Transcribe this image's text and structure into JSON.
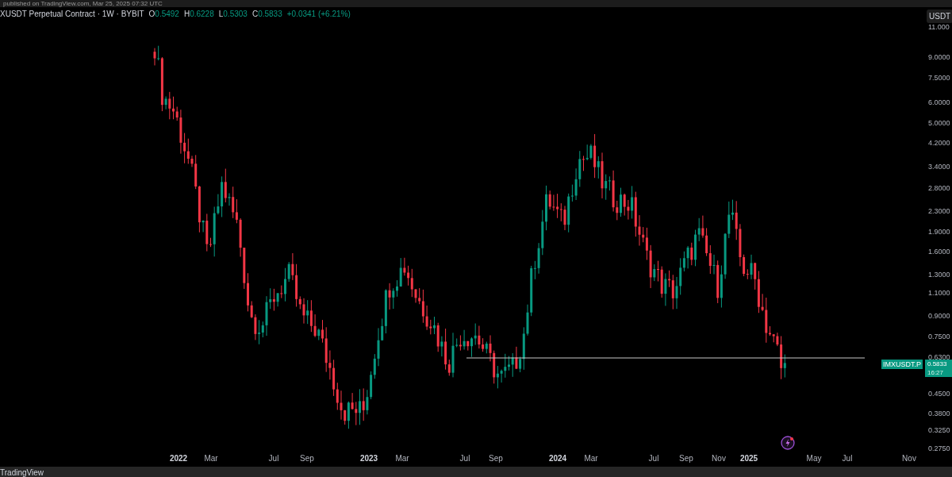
{
  "caption": "published on TradingView.com, Mar 25, 2025 07:32 UTC",
  "legend": {
    "symbol": "XUSDT Perpetual Contract · 1W · BYBIT",
    "ohlc": [
      {
        "label": "O",
        "value": "0.5492"
      },
      {
        "label": "H",
        "value": "0.6228"
      },
      {
        "label": "L",
        "value": "0.5303"
      },
      {
        "label": "C",
        "value": "0.5833"
      }
    ],
    "change": "+0.0341 (+6.21%)"
  },
  "currency_button": "USDT",
  "price_axis": [
    "11.000",
    "9.0000",
    "7.5000",
    "6.0000",
    "5.0000",
    "4.2000",
    "3.4000",
    "2.8000",
    "2.3000",
    "1.9000",
    "1.6000",
    "1.3000",
    "1.1000",
    "0.9000",
    "0.7500",
    "0.6300",
    "0.4500",
    "0.3800",
    "0.3250",
    "0.2750"
  ],
  "price_tag": {
    "symbol": "IMXUSDT.P",
    "price": "0.5833",
    "countdown": "16:27"
  },
  "time_axis": [
    {
      "label": "2022",
      "kind": "year"
    },
    {
      "label": "Mar",
      "kind": "month"
    },
    {
      "label": "Jul",
      "kind": "month"
    },
    {
      "label": "Sep",
      "kind": "month"
    },
    {
      "label": "2023",
      "kind": "year"
    },
    {
      "label": "Mar",
      "kind": "month"
    },
    {
      "label": "Jul",
      "kind": "month"
    },
    {
      "label": "Sep",
      "kind": "month"
    },
    {
      "label": "2024",
      "kind": "year"
    },
    {
      "label": "Mar",
      "kind": "month"
    },
    {
      "label": "Jul",
      "kind": "month"
    },
    {
      "label": "Sep",
      "kind": "month"
    },
    {
      "label": "Nov",
      "kind": "month"
    },
    {
      "label": "2025",
      "kind": "year"
    },
    {
      "label": "May",
      "kind": "month"
    },
    {
      "label": "Jul",
      "kind": "month"
    },
    {
      "label": "Nov",
      "kind": "month"
    }
  ],
  "footer": "TradingView"
}
